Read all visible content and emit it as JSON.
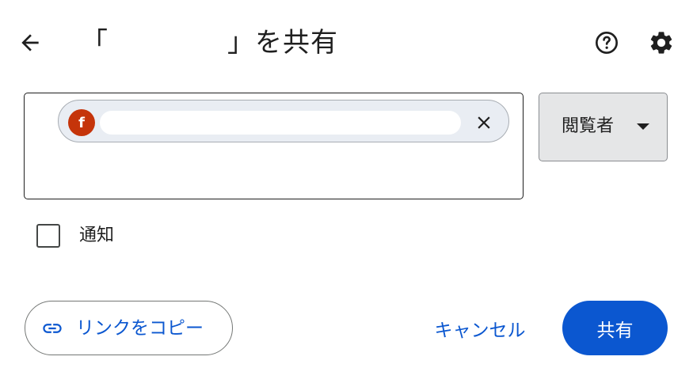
{
  "header": {
    "title_open_bracket": "「",
    "title_close_bracket": "」を共有",
    "back_icon": "arrow-back-icon",
    "help_icon": "help-icon",
    "settings_icon": "gear-icon"
  },
  "recipients": {
    "chips": [
      {
        "avatar_letter": "f",
        "avatar_color": "#c5340a"
      }
    ]
  },
  "role": {
    "selected": "閲覧者"
  },
  "notify": {
    "label": "通知",
    "checked": false
  },
  "footer": {
    "copy_link_label": "リンクをコピー",
    "cancel_label": "キャンセル",
    "share_label": "共有"
  },
  "colors": {
    "accent": "#0b57d0",
    "role_bg": "#e5e6e7",
    "chip_bg": "#e9edf3"
  }
}
